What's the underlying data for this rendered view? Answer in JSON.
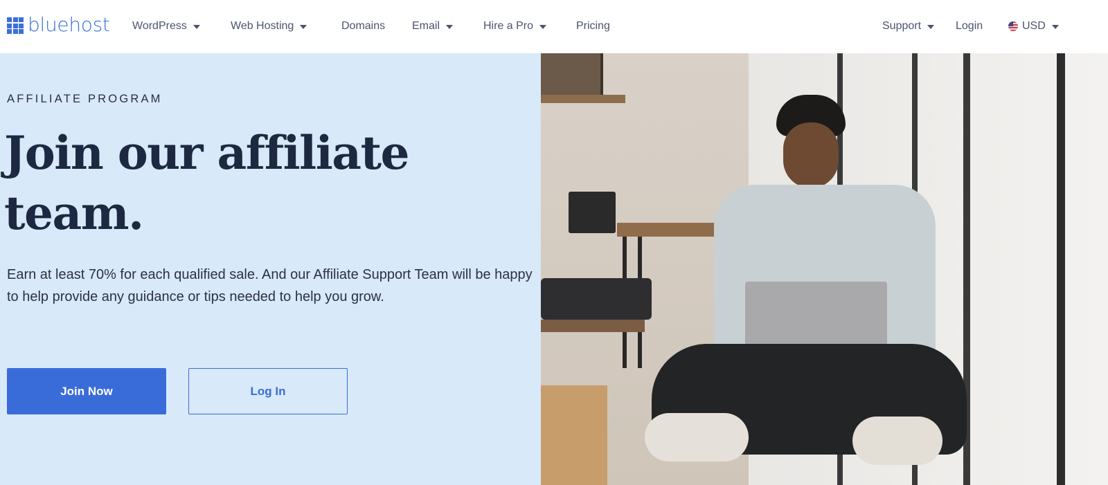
{
  "brand": {
    "name": "bluehost",
    "color": "#3a6fd8"
  },
  "nav": {
    "left_items": [
      {
        "label": "WordPress",
        "has_dropdown": true
      },
      {
        "label": "Web Hosting",
        "has_dropdown": true
      },
      {
        "label": "Domains",
        "has_dropdown": false
      },
      {
        "label": "Email",
        "has_dropdown": true
      },
      {
        "label": "Hire a Pro",
        "has_dropdown": true
      },
      {
        "label": "Pricing",
        "has_dropdown": false
      }
    ],
    "right_items": [
      {
        "label": "Support",
        "has_dropdown": true
      },
      {
        "label": "Login",
        "has_dropdown": false
      },
      {
        "label": "USD",
        "has_dropdown": true,
        "icon": "us-flag-icon"
      }
    ]
  },
  "hero": {
    "eyebrow": "AFFILIATE PROGRAM",
    "headline": "Join our affiliate team.",
    "body": "Earn at least 70% for each qualified sale. And our Affiliate Support Team will be happy to help provide any guidance or tips needed to help you grow.",
    "primary_button": "Join Now",
    "secondary_button": "Log In",
    "image_alt": "Man sitting cross-legged using a laptop by a window",
    "background_color": "#d8e9f9",
    "accent_color": "#3a6cd9",
    "heading_color": "#1c2940"
  }
}
